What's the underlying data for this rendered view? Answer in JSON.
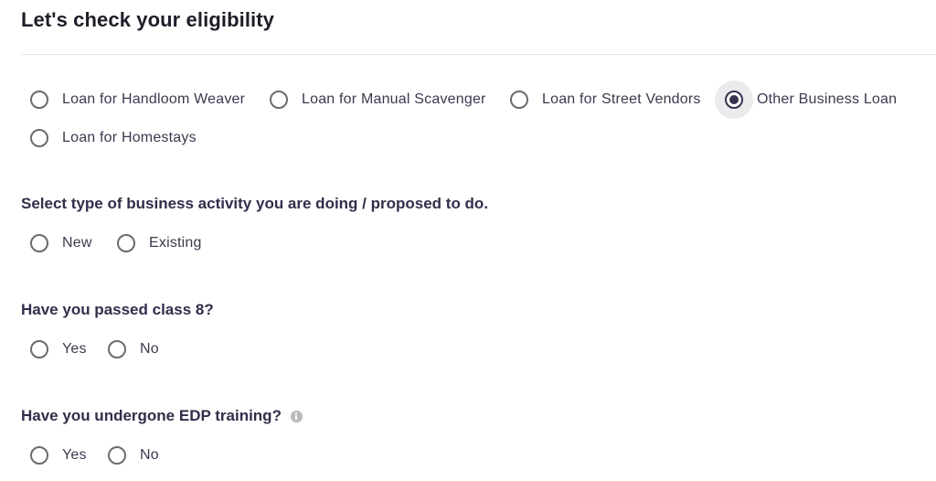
{
  "page_title": "Let's check your eligibility",
  "loan_types": {
    "options": [
      {
        "label": "Loan for Handloom Weaver",
        "selected": false
      },
      {
        "label": "Loan for Manual Scavenger",
        "selected": false
      },
      {
        "label": "Loan for Street Vendors",
        "selected": false
      },
      {
        "label": "Other Business Loan",
        "selected": true
      },
      {
        "label": "Loan for Homestays",
        "selected": false
      }
    ]
  },
  "business_activity": {
    "question": "Select type of business activity you are doing / proposed to do.",
    "options": [
      {
        "label": "New",
        "selected": false
      },
      {
        "label": "Existing",
        "selected": false
      }
    ]
  },
  "class8": {
    "question": "Have you passed class 8?",
    "options": [
      {
        "label": "Yes",
        "selected": false
      },
      {
        "label": "No",
        "selected": false
      }
    ]
  },
  "edp_training": {
    "question": "Have you undergone EDP training?",
    "info_icon": "info-icon",
    "options": [
      {
        "label": "Yes",
        "selected": false
      },
      {
        "label": "No",
        "selected": false
      }
    ]
  },
  "colors": {
    "accent": "#353350",
    "radio_border": "#6a6a72",
    "divider": "#e6e6e9"
  }
}
